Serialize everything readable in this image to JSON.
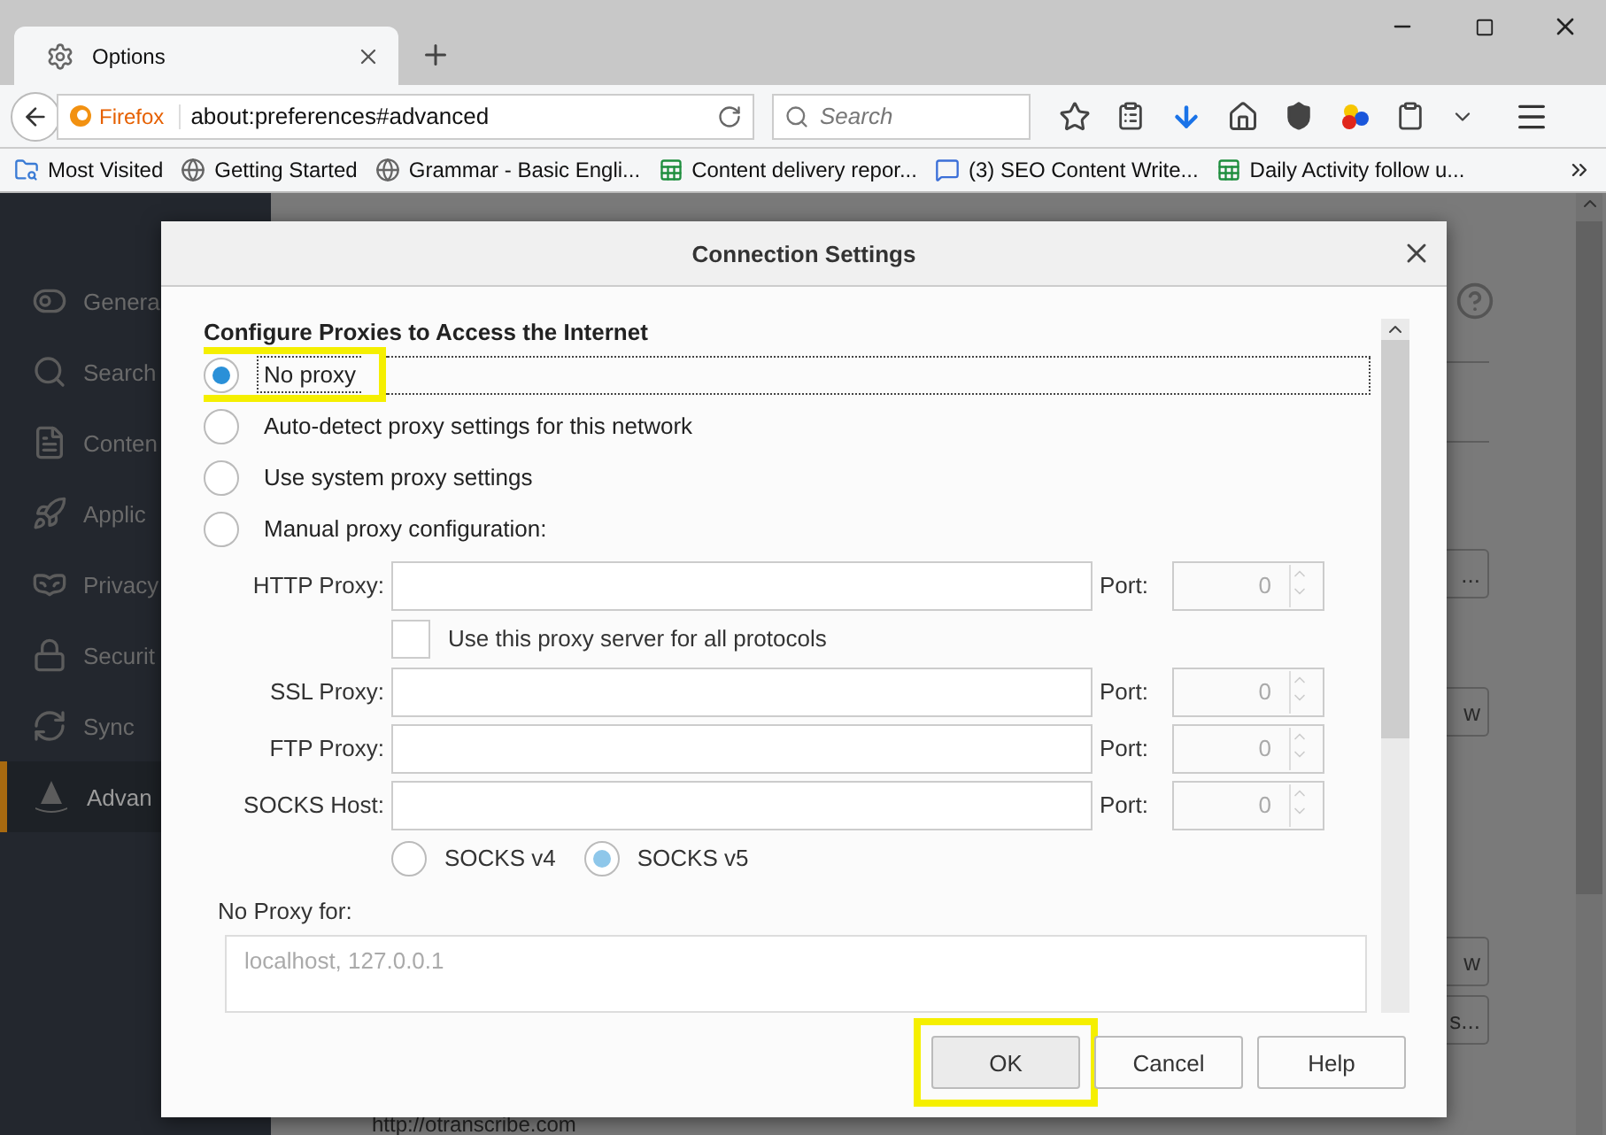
{
  "tabs": [
    {
      "label": "Options",
      "selected": true
    }
  ],
  "toolbar": {
    "identity": "Firefox",
    "url": "about:preferences#advanced",
    "search_placeholder": "Search"
  },
  "bookmarks": [
    {
      "label": "Most Visited",
      "kind": "folder"
    },
    {
      "label": "Getting Started",
      "kind": "globe"
    },
    {
      "label": "Grammar - Basic Engli...",
      "kind": "globe"
    },
    {
      "label": "Content delivery repor...",
      "kind": "sheet"
    },
    {
      "label": "(3) SEO Content Write...",
      "kind": "chat"
    },
    {
      "label": "Daily Activity follow u...",
      "kind": "sheet"
    }
  ],
  "sidebar": {
    "items": [
      {
        "label": "Genera",
        "kind": "general",
        "selected": false
      },
      {
        "label": "Search",
        "kind": "search",
        "selected": false
      },
      {
        "label": "Conten",
        "kind": "content",
        "selected": false
      },
      {
        "label": "Applic",
        "kind": "applications",
        "selected": false
      },
      {
        "label": "Privacy",
        "kind": "privacy",
        "selected": false
      },
      {
        "label": "Securit",
        "kind": "security",
        "selected": false
      },
      {
        "label": "Sync",
        "kind": "sync",
        "selected": false
      },
      {
        "label": "Advan",
        "kind": "advanced",
        "selected": true
      }
    ]
  },
  "page_buttons": [
    "...",
    "w",
    "w",
    "s..."
  ],
  "page_link": "http://otranscribe.com",
  "dialog": {
    "title": "Connection Settings",
    "heading": "Configure Proxies to Access the Internet",
    "options": [
      {
        "label": "No proxy",
        "selected": true,
        "highlighted": true
      },
      {
        "label": "Auto-detect proxy settings for this network",
        "selected": false,
        "highlighted": false
      },
      {
        "label": "Use system proxy settings",
        "selected": false,
        "highlighted": false
      },
      {
        "label": "Manual proxy configuration:",
        "selected": false,
        "highlighted": false
      }
    ],
    "manual": {
      "disabled": true,
      "rows": [
        {
          "kind": "proxy",
          "label": "HTTP Proxy:",
          "port_label": "Port:",
          "port": "0"
        },
        {
          "kind": "checkbox",
          "label": "Use this proxy server for all protocols",
          "checked": false
        },
        {
          "kind": "proxy",
          "label": "SSL Proxy:",
          "port_label": "Port:",
          "port": "0"
        },
        {
          "kind": "proxy",
          "label": "FTP Proxy:",
          "port_label": "Port:",
          "port": "0"
        },
        {
          "kind": "proxy",
          "label": "SOCKS Host:",
          "port_label": "Port:",
          "port": "0"
        }
      ],
      "socks_versions": [
        {
          "label": "SOCKS v4",
          "selected": false
        },
        {
          "label": "SOCKS v5",
          "selected": true
        }
      ]
    },
    "no_proxy": {
      "label": "No Proxy for:",
      "value": "localhost, 127.0.0.1"
    },
    "buttons": [
      {
        "label": "OK",
        "default": true,
        "highlighted": true
      },
      {
        "label": "Cancel",
        "default": false,
        "highlighted": false
      },
      {
        "label": "Help",
        "default": false,
        "highlighted": false
      }
    ]
  }
}
